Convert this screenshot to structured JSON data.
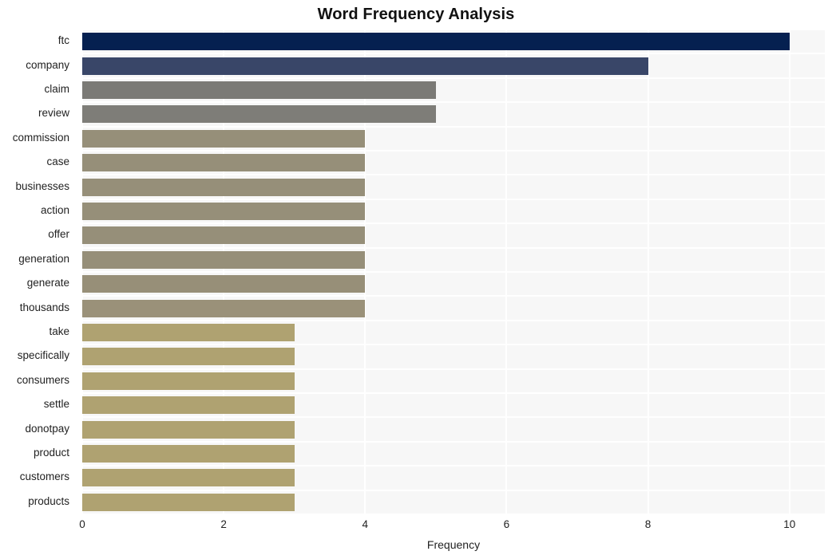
{
  "chart_data": {
    "type": "bar",
    "orientation": "horizontal",
    "title": "Word Frequency Analysis",
    "xlabel": "Frequency",
    "ylabel": "",
    "categories": [
      "ftc",
      "company",
      "claim",
      "review",
      "commission",
      "case",
      "businesses",
      "action",
      "offer",
      "generation",
      "generate",
      "thousands",
      "take",
      "specifically",
      "consumers",
      "settle",
      "donotpay",
      "product",
      "customers",
      "products"
    ],
    "values": [
      10,
      8,
      5,
      5,
      4,
      4,
      4,
      4,
      4,
      4,
      4,
      4,
      3,
      3,
      3,
      3,
      3,
      3,
      3,
      3
    ],
    "bar_colors": [
      "#052050",
      "#394668",
      "#7b7a76",
      "#7e7d78",
      "#968f79",
      "#968f79",
      "#968f79",
      "#968f79",
      "#968f79",
      "#968f79",
      "#978f78",
      "#9a9179",
      "#afa271",
      "#afa271",
      "#afa271",
      "#afa271",
      "#afa271",
      "#afa271",
      "#afa271",
      "#afa271"
    ],
    "xticks": [
      "0",
      "2",
      "4",
      "6",
      "8",
      "10"
    ],
    "xtick_values": [
      0,
      2,
      4,
      6,
      8,
      10
    ],
    "xlim": [
      0,
      10.5
    ],
    "grid": true,
    "grid_color": "#ffffff",
    "plot_background": "#f7f7f7",
    "figure_background": "#ffffff",
    "legend": null
  }
}
